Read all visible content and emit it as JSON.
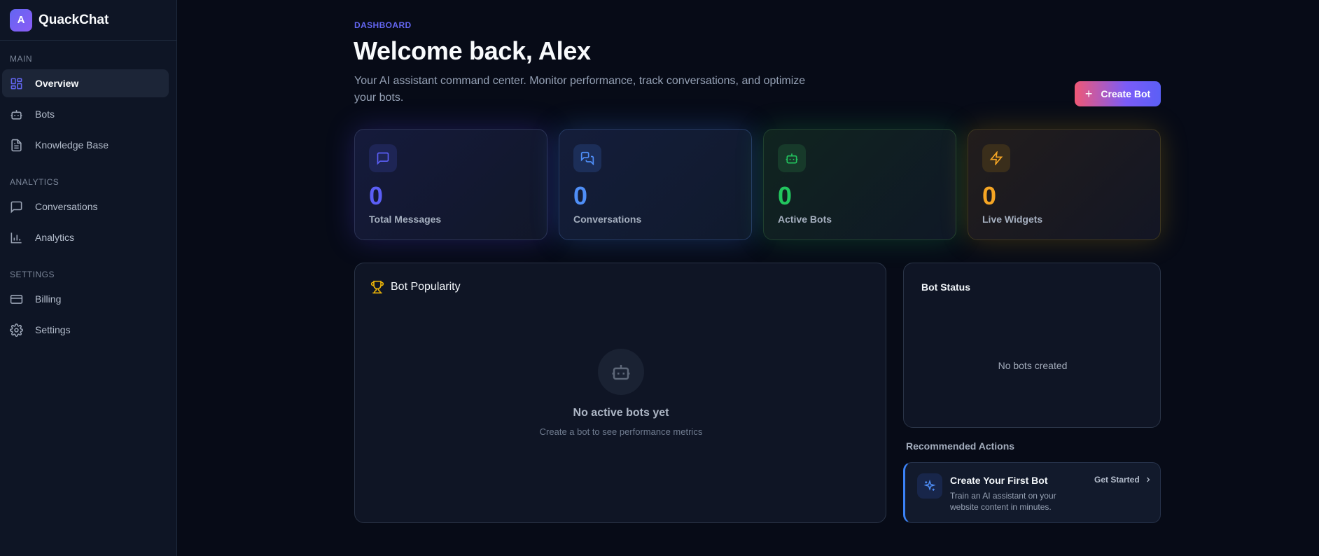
{
  "brand": {
    "logo_letter": "A",
    "name": "QuackChat"
  },
  "sidebar": {
    "sections": [
      {
        "title": "MAIN"
      },
      {
        "title": "ANALYTICS"
      },
      {
        "title": "SETTINGS"
      }
    ],
    "items": [
      {
        "label": "Overview",
        "icon": "grid-icon",
        "active": true
      },
      {
        "label": "Bots",
        "icon": "bot-icon"
      },
      {
        "label": "Knowledge Base",
        "icon": "document-icon"
      },
      {
        "label": "Conversations",
        "icon": "chat-bubble-icon"
      },
      {
        "label": "Analytics",
        "icon": "bar-chart-icon"
      },
      {
        "label": "Billing",
        "icon": "credit-card-icon"
      },
      {
        "label": "Settings",
        "icon": "gear-icon"
      }
    ]
  },
  "header": {
    "breadcrumb": "DASHBOARD",
    "title": "Welcome back, Alex",
    "subtitle": "Your AI assistant command center. Monitor performance, track conversations, and optimize your bots.",
    "create_button": {
      "icon": "plus-icon",
      "label": "Create Bot"
    }
  },
  "stats": [
    {
      "value": "0",
      "label": "Total Messages",
      "icon": "message-icon",
      "color": "#5b5ef6"
    },
    {
      "value": "0",
      "label": "Conversations",
      "icon": "messages-icon",
      "color": "#4f8ef7"
    },
    {
      "value": "0",
      "label": "Active Bots",
      "icon": "bot-icon",
      "color": "#22c55e"
    },
    {
      "value": "0",
      "label": "Live Widgets",
      "icon": "lightning-icon",
      "color": "#f5a524"
    }
  ],
  "popularity": {
    "title": "Bot Popularity",
    "title_icon": "trophy-icon",
    "empty_icon": "bot-icon",
    "empty_title": "No active bots yet",
    "empty_subtitle": "Create a bot to see performance metrics"
  },
  "bot_status": {
    "title": "Bot Status",
    "empty_text": "No bots created"
  },
  "recommended": {
    "title": "Recommended Actions",
    "card": {
      "icon": "sparkles-icon",
      "title": "Create Your First Bot",
      "description": "Train an AI assistant on your website content in minutes.",
      "link_label": "Get Started",
      "link_icon": "chevron-right-icon"
    }
  },
  "colors": {
    "accent": "#6366f1",
    "background": "#070b17",
    "sidebar": "#0e1525",
    "blue": "#3b82f6",
    "green": "#22c55e",
    "amber": "#f5a524"
  }
}
